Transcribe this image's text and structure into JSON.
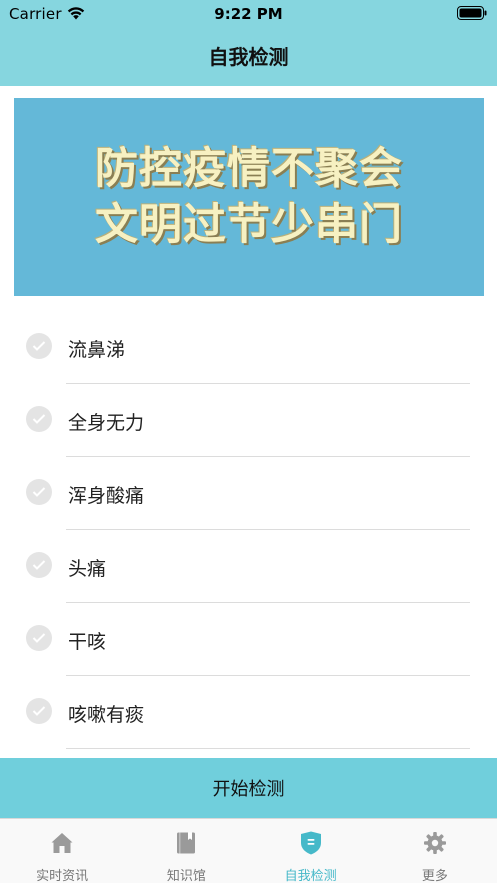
{
  "status_bar": {
    "carrier": "Carrier",
    "time": "9:22 PM"
  },
  "nav": {
    "title": "自我检测"
  },
  "banner": {
    "line1": "防控疫情不聚会",
    "line2": "文明过节少串门"
  },
  "symptoms": [
    {
      "label": "流鼻涕"
    },
    {
      "label": "全身无力"
    },
    {
      "label": "浑身酸痛"
    },
    {
      "label": "头痛"
    },
    {
      "label": "干咳"
    },
    {
      "label": "咳嗽有痰"
    }
  ],
  "start_button": {
    "label": "开始检测"
  },
  "tabs": [
    {
      "label": "实时资讯",
      "icon": "home-icon"
    },
    {
      "label": "知识馆",
      "icon": "book-icon"
    },
    {
      "label": "自我检测",
      "icon": "shield-icon",
      "active": true
    },
    {
      "label": "更多",
      "icon": "gear-icon"
    }
  ],
  "colors": {
    "header": "#86d6df",
    "banner": "#64b8d8",
    "button": "#70cfdc",
    "tab_active": "#46b9c9",
    "tab_inactive": "#9a9a9a"
  }
}
